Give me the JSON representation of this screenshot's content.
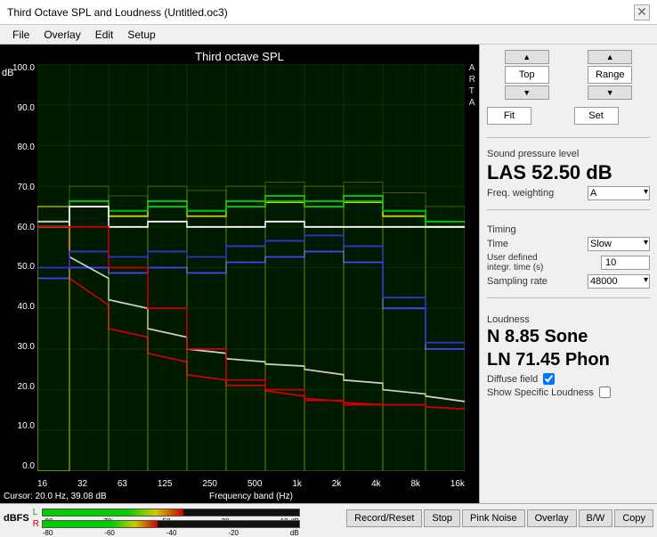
{
  "window": {
    "title": "Third Octave SPL and Loudness (Untitled.oc3)",
    "close_label": "✕"
  },
  "menu": {
    "items": [
      "File",
      "Overlay",
      "Edit",
      "Setup"
    ]
  },
  "chart": {
    "title": "Third octave SPL",
    "arta_label": "A\nR\nT\nA",
    "y_axis_title": "dB",
    "y_labels": [
      "100.0",
      "90.0",
      "80.0",
      "70.0",
      "60.0",
      "50.0",
      "40.0",
      "30.0",
      "20.0",
      "10.0",
      "0.0"
    ],
    "x_labels": [
      "16",
      "32",
      "63",
      "125",
      "250",
      "500",
      "1k",
      "2k",
      "4k",
      "8k",
      "16k"
    ],
    "cursor_info": "Cursor:  20.0 Hz, 39.08 dB",
    "freq_label": "Frequency band (Hz)"
  },
  "controls": {
    "top_label": "Top",
    "range_label": "Range",
    "fit_label": "Fit",
    "set_label": "Set"
  },
  "spl": {
    "section_label": "Sound pressure level",
    "value": "LAS 52.50 dB",
    "freq_weighting_label": "Freq. weighting",
    "freq_weighting_value": "A"
  },
  "timing": {
    "section_label": "Timing",
    "time_label": "Time",
    "time_value": "Slow",
    "user_defined_label": "User defined\nintegr. time (s)",
    "user_defined_value": "10",
    "sampling_rate_label": "Sampling rate",
    "sampling_rate_value": "48000"
  },
  "loudness": {
    "section_label": "Loudness",
    "n_value": "N 8.85 Sone",
    "ln_value": "LN 71.45 Phon",
    "diffuse_field_label": "Diffuse field",
    "diffuse_field_checked": true,
    "show_specific_label": "Show Specific Loudness",
    "show_specific_checked": false
  },
  "bottom": {
    "dbfs_label": "dBFS",
    "meter_labels_L": [
      "L"
    ],
    "meter_labels_R": [
      "R"
    ],
    "tick_labels": [
      "-90",
      "-70",
      "-50",
      "-30",
      "-10 dB"
    ],
    "tick_labels2": [
      "-80",
      "-60",
      "-40",
      "-20",
      "dB"
    ],
    "buttons": [
      "Record/Reset",
      "Stop",
      "Pink Noise",
      "Overlay",
      "B/W",
      "Copy"
    ]
  }
}
